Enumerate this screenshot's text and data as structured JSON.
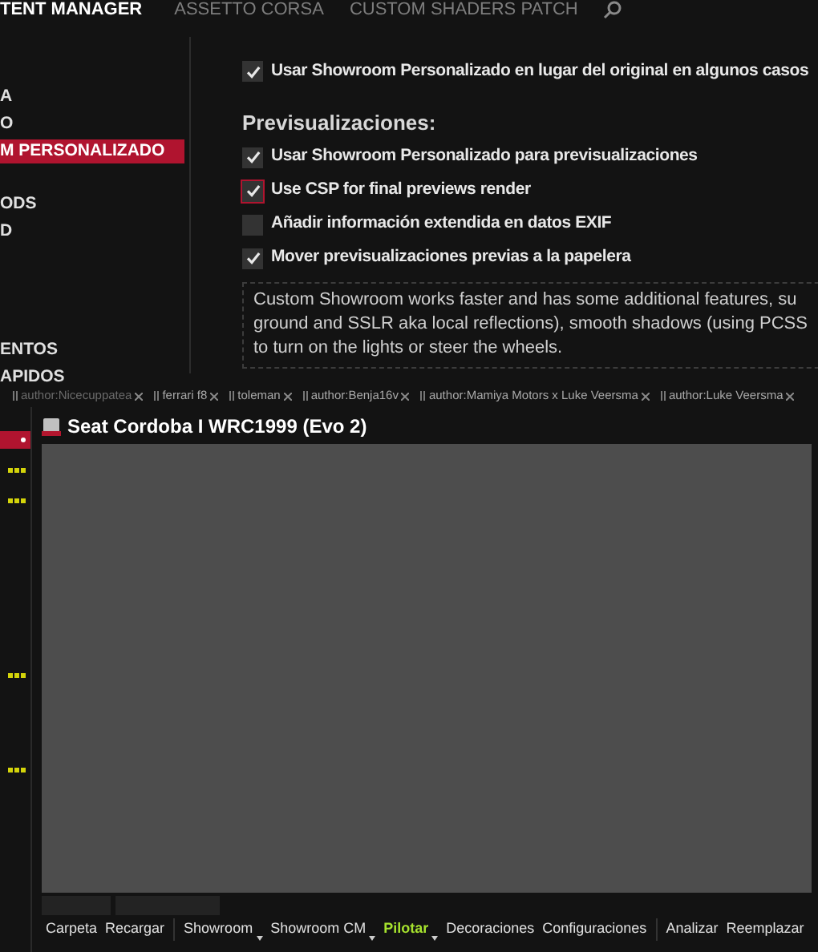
{
  "top_nav": [
    {
      "label": "TENT MANAGER",
      "selected": true
    },
    {
      "label": "ASSETTO CORSA",
      "selected": false
    },
    {
      "label": "CUSTOM SHADERS PATCH",
      "selected": false
    }
  ],
  "sidebar": {
    "items": [
      {
        "label": "A",
        "selected": false
      },
      {
        "label": "O",
        "selected": false
      },
      {
        "label": "M PERSONALIZADO",
        "selected": true
      },
      {
        "label": "ODS",
        "selected": false
      },
      {
        "label": "D",
        "selected": false
      },
      {
        "label": "ENTOS",
        "selected": false
      },
      {
        "label": "APIDOS",
        "selected": false
      }
    ]
  },
  "settings": {
    "top_option": {
      "label": "Usar Showroom Personalizado en lugar del original en algunos casos",
      "checked": true,
      "focused": false
    },
    "section_title": "Previsualizaciones:",
    "options": [
      {
        "label": "Usar Showroom Personalizado para previsualizaciones",
        "checked": true,
        "focused": false
      },
      {
        "label": "Use CSP for final previews render",
        "checked": true,
        "focused": true
      },
      {
        "label": "Añadir información extendida en datos EXIF",
        "checked": false,
        "focused": false
      },
      {
        "label": "Mover previsualizaciones previas a la papelera",
        "checked": true,
        "focused": false
      }
    ],
    "info_lines": [
      "Custom Showroom works faster and has some additional features, su",
      "ground and SSLR aka local reflections), smooth shadows (using PCSS",
      "to turn on the lights or steer the wheels."
    ]
  },
  "tags": [
    "author:Nicecuppatea",
    "ferrari f8",
    "toleman",
    "author:Benja16v",
    "author:Mamiya Motors x Luke Veersma",
    "author:Luke Veersma"
  ],
  "car_list": [
    {
      "selected": true
    },
    {
      "selected": false
    },
    {
      "selected": false
    },
    {
      "selected": false
    },
    {
      "selected": false
    }
  ],
  "car": {
    "title": "Seat Cordoba I WRC1999 (Evo 2)"
  },
  "toolbar": [
    {
      "label": "Carpeta",
      "dropdown": false,
      "highlighted": false,
      "separator_before": false
    },
    {
      "label": "Recargar",
      "dropdown": false,
      "highlighted": false,
      "separator_before": false
    },
    {
      "label": "Showroom",
      "dropdown": true,
      "highlighted": false,
      "separator_before": true
    },
    {
      "label": "Showroom CM",
      "dropdown": true,
      "highlighted": false,
      "separator_before": false
    },
    {
      "label": "Pilotar",
      "dropdown": true,
      "highlighted": true,
      "separator_before": false
    },
    {
      "label": "Decoraciones",
      "dropdown": false,
      "highlighted": false,
      "separator_before": false
    },
    {
      "label": "Configuraciones",
      "dropdown": false,
      "highlighted": false,
      "separator_before": false
    },
    {
      "label": "Analizar",
      "dropdown": false,
      "highlighted": false,
      "separator_before": true
    },
    {
      "label": "Reemplazar",
      "dropdown": false,
      "highlighted": false,
      "separator_before": false
    }
  ]
}
